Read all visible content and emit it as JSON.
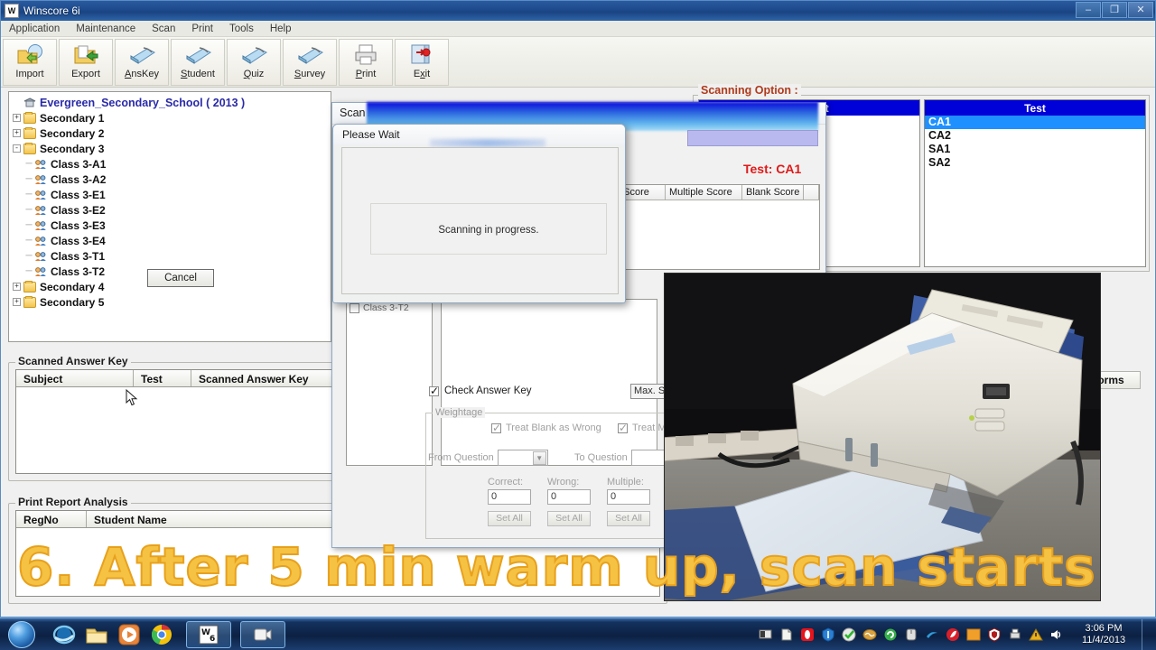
{
  "window": {
    "title": "Winscore 6i",
    "icon": "winscore-app-icon",
    "buttons": {
      "minimize": "–",
      "maximize": "❐",
      "close": "✕"
    }
  },
  "menubar": {
    "items": [
      "Application",
      "Maintenance",
      "Scan",
      "Print",
      "Tools",
      "Help"
    ]
  },
  "toolbar": {
    "buttons": [
      {
        "label": "Import",
        "icon": "import-folder-icon"
      },
      {
        "label": "Export",
        "icon": "export-folder-icon"
      },
      {
        "label": "AnsKey",
        "icon": "scanner-icon"
      },
      {
        "label": "Student",
        "icon": "scanner-icon"
      },
      {
        "label": "Quiz",
        "icon": "scanner-icon"
      },
      {
        "label": "Survey",
        "icon": "scanner-icon"
      },
      {
        "label": "Print",
        "icon": "printer-icon"
      },
      {
        "label": "Exit",
        "icon": "exit-door-icon"
      }
    ]
  },
  "tree": {
    "root": {
      "label": "Evergreen_Secondary_School  ( 2013 )",
      "icon": "school-icon"
    },
    "nodes": [
      {
        "label": "Secondary 1",
        "expander": "+",
        "icon": "folder-icon",
        "children": []
      },
      {
        "label": "Secondary 2",
        "expander": "+",
        "icon": "folder-icon",
        "children": []
      },
      {
        "label": "Secondary 3",
        "expander": "-",
        "icon": "folder-icon",
        "children": [
          {
            "label": "Class 3-A1",
            "icon": "class-icon"
          },
          {
            "label": "Class 3-A2",
            "icon": "class-icon"
          },
          {
            "label": "Class 3-E1",
            "icon": "class-icon"
          },
          {
            "label": "Class 3-E2",
            "icon": "class-icon"
          },
          {
            "label": "Class 3-E3",
            "icon": "class-icon"
          },
          {
            "label": "Class 3-E4",
            "icon": "class-icon"
          },
          {
            "label": "Class 3-T1",
            "icon": "class-icon"
          },
          {
            "label": "Class 3-T2",
            "icon": "class-icon"
          }
        ]
      },
      {
        "label": "Secondary 4",
        "expander": "+",
        "icon": "folder-icon",
        "children": []
      },
      {
        "label": "Secondary 5",
        "expander": "+",
        "icon": "folder-icon",
        "children": []
      }
    ]
  },
  "scanned_answer_key": {
    "title": "Scanned Answer Key",
    "columns": [
      "Subject",
      "Test",
      "Scanned Answer Key"
    ],
    "rows": []
  },
  "print_report_analysis": {
    "title": "Print Report Analysis",
    "columns": [
      "RegNo",
      "Student Name"
    ],
    "rows": []
  },
  "scanning_option": {
    "title": "Scanning Option :",
    "subject_list": {
      "header": "Subject",
      "items": []
    },
    "test_list": {
      "header": "Test",
      "items": [
        "CA1",
        "CA2",
        "SA1",
        "SA2"
      ],
      "selected": "CA1"
    }
  },
  "scan_window": {
    "title": "Scan Answer Key",
    "test_label": "Test: CA1",
    "score_columns": [
      "g Score",
      "Multiple Score",
      "Blank Score"
    ],
    "class_checkbox": {
      "label": "Class 3-T2",
      "checked": false
    },
    "check_answer_key": {
      "label": "Check Answer Key",
      "checked": true
    },
    "max_score_field": "Max. Sc",
    "forms_button": "Forms",
    "weightage": {
      "title": "Weightage",
      "treat_blank_as_wrong": {
        "label": "Treat Blank as Wrong",
        "checked": true
      },
      "treat_multiple": {
        "label": "Treat Mu",
        "checked": true
      },
      "from_question": {
        "label": "From Question",
        "value": ""
      },
      "to_question": {
        "label": "To Question",
        "value": ""
      },
      "correct": {
        "label": "Correct:",
        "value": "0",
        "set_all": "Set All"
      },
      "wrong": {
        "label": "Wrong:",
        "value": "0",
        "set_all": "Set All"
      },
      "multiple": {
        "label": "Multiple:",
        "value": "0",
        "set_all": "Set All"
      }
    }
  },
  "please_wait_dialog": {
    "title": "Please Wait",
    "message": "Scanning in progress.",
    "cancel_button": "Cancel"
  },
  "overlay": {
    "photo_alt": "document-scanner-photo",
    "caption": "6. After 5 min warm up, scan starts"
  },
  "taskbar": {
    "start": "start-orb-icon",
    "pinned": [
      {
        "icon": "internet-explorer-icon"
      },
      {
        "icon": "windows-explorer-icon"
      },
      {
        "icon": "media-player-icon"
      },
      {
        "icon": "google-chrome-icon"
      }
    ],
    "tasks": [
      {
        "icon": "winscore-task-icon"
      },
      {
        "icon": "camtasia-task-icon"
      }
    ],
    "tray": [
      {
        "icon": "monitor-icon"
      },
      {
        "icon": "document-icon"
      },
      {
        "icon": "opera-icon"
      },
      {
        "icon": "shield-icon"
      },
      {
        "icon": "check-green-icon"
      },
      {
        "icon": "network-brain-icon"
      },
      {
        "icon": "sync-green-icon"
      },
      {
        "icon": "mouse-icon"
      },
      {
        "icon": "blue-swirl-icon"
      },
      {
        "icon": "red-leaf-icon"
      },
      {
        "icon": "orange-square-icon"
      },
      {
        "icon": "shield-red-icon"
      },
      {
        "icon": "printer-tray-icon"
      },
      {
        "icon": "warning-icon"
      },
      {
        "icon": "volume-icon"
      }
    ],
    "clock": {
      "time": "3:06 PM",
      "date": "11/4/2013"
    }
  },
  "colors": {
    "accent_blue": "#0000d8",
    "selection_blue": "#1e90ff",
    "scanning_option_red": "#b03a1a",
    "test_label_red": "#e01919",
    "caption_yellow": "#f5c243",
    "tree_root_blue": "#2a2aa8"
  }
}
